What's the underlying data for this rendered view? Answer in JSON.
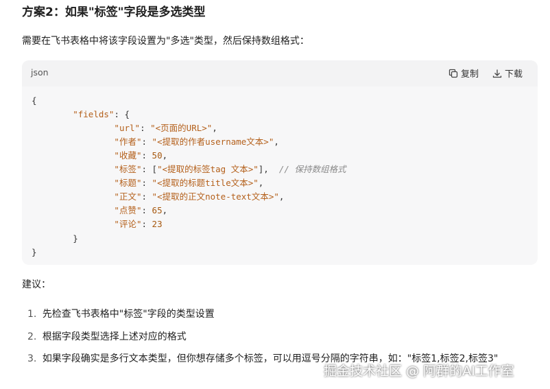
{
  "heading": "方案2：如果\"标签\"字段是多选类型",
  "intro": "需要在飞书表格中将该字段设置为\"多选\"类型，然后保持数组格式：",
  "code": {
    "language": "json",
    "copy_label": "复制",
    "download_label": "下载",
    "lines": {
      "l1": "{",
      "l2_key": "\"fields\"",
      "l2_punc": ": {",
      "url_key": "\"url\"",
      "url_val": "\"<页面的URL>\"",
      "author_key": "\"作者\"",
      "author_val": "\"<提取的作者username文本>\"",
      "fav_key": "\"收藏\"",
      "fav_val": "50",
      "tag_key": "\"标签\"",
      "tag_val": "\"<提取的标签tag 文本>\"",
      "tag_comment": "// 保持数组格式",
      "title_key": "\"标题\"",
      "title_val": "\"<提取的标题title文本>\"",
      "body_key": "\"正文\"",
      "body_val": "\"<提取的正文note-text文本>\"",
      "like_key": "\"点赞\"",
      "like_val": "65",
      "comment_key": "\"评论\"",
      "comment_val": "23",
      "close_inner": "}",
      "close_outer": "}"
    }
  },
  "advice_label": "建议：",
  "list": [
    {
      "num": "1.",
      "text": "先检查飞书表格中\"标签\"字段的类型设置"
    },
    {
      "num": "2.",
      "text": "根据字段类型选择上述对应的格式"
    },
    {
      "num": "3.",
      "text": "如果字段确实是多行文本类型，但你想存储多个标签，可以用逗号分隔的字符串，如：\"标签1,标签2,标签3\""
    }
  ],
  "watermark": "掘金技术社区 @ 阿群的AI工作室"
}
